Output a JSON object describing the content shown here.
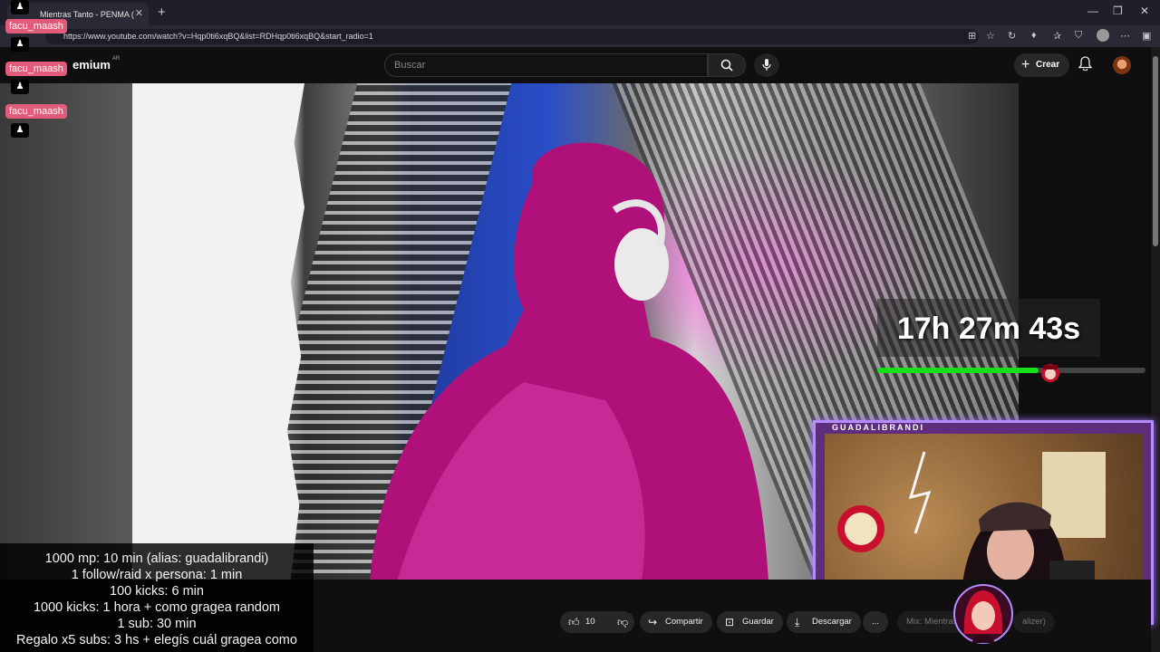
{
  "browser": {
    "tab_title": "Mientras Tanto - PENMA (Vis",
    "tab_close": "✕",
    "new_tab": "+",
    "url": "https://www.youtube.com/watch?v=Hqp0ti6xqBQ&list=RDHqp0ti6xqBQ&start_radio=1",
    "window_controls": [
      "—",
      "❐",
      "✕"
    ]
  },
  "youtube": {
    "logo_text": "emium",
    "logo_region": "AR",
    "search_placeholder": "Buscar",
    "create_label": "Crear"
  },
  "chat": [
    {
      "user": "facu_maash"
    },
    {
      "user": "facu_maash"
    },
    {
      "user": "facu_maash"
    }
  ],
  "timer": {
    "text": "17h 27m 43s",
    "progress_fraction": 0.6
  },
  "goals": [
    "1000 mp: 10 min (alias: guadalibrandi)",
    "1 follow/raid x persona: 1 min",
    "100 kicks: 6 min",
    "1000 kicks: 1 hora + como gragea random",
    "1 sub: 30 min",
    "Regalo x5 subs: 3 hs + elegís cuál gragea como"
  ],
  "webcam": {
    "streamer_name": "GUADALIBRANDI"
  },
  "actions": {
    "like_count": "10",
    "share_label": "Compartir",
    "save_label": "Guardar",
    "download_label": "Descargar",
    "more_label": "...",
    "mix_label": "Mix: Mientras",
    "mix_suffix": "alizer)"
  },
  "colors": {
    "accent_pink": "#e25b7a",
    "timer_bar": "#18e018",
    "cam_border": "#b48cff"
  }
}
